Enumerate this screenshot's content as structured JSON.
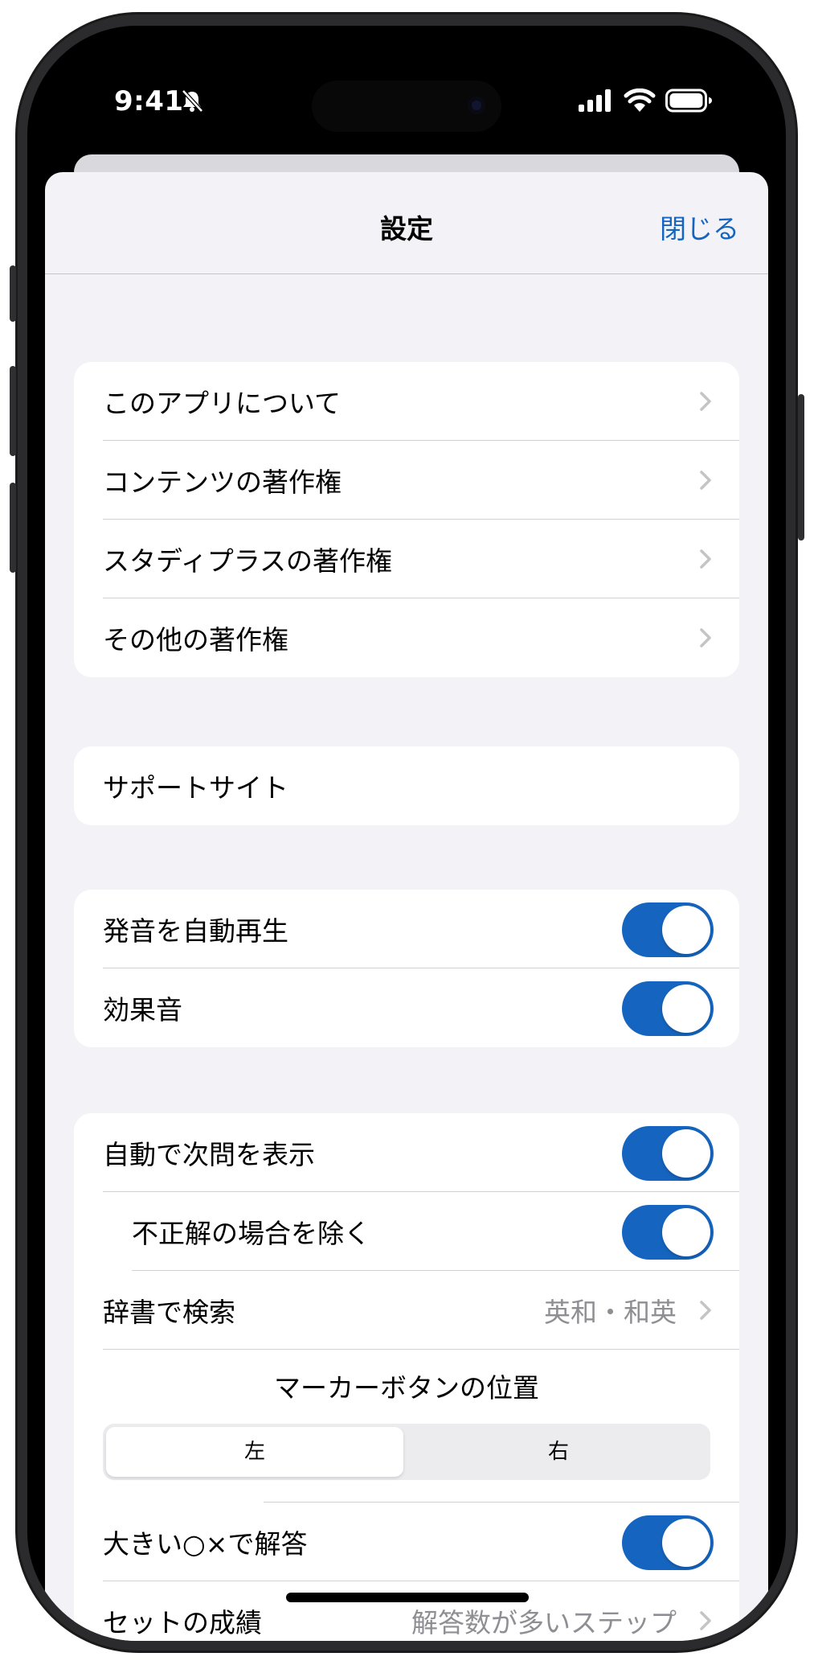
{
  "status_bar": {
    "time": "9:41"
  },
  "nav": {
    "title": "設定",
    "close_label": "閉じる"
  },
  "group1": [
    {
      "label": "このアプリについて"
    },
    {
      "label": "コンテンツの著作権"
    },
    {
      "label": "スタディプラスの著作権"
    },
    {
      "label": "その他の著作権"
    }
  ],
  "group2": [
    {
      "label": "サポートサイト"
    }
  ],
  "group3": [
    {
      "label": "発音を自動再生",
      "on": true
    },
    {
      "label": "効果音",
      "on": true
    }
  ],
  "group4": {
    "auto_next": {
      "label": "自動で次問を表示",
      "on": true
    },
    "exclude_wrong": {
      "label": "不正解の場合を除く",
      "on": true
    },
    "dictionary": {
      "label": "辞書で検索",
      "value": "英和・和英"
    },
    "marker_title": "マーカーボタンの位置",
    "marker_options": [
      "左",
      "右"
    ],
    "marker_selected": "左",
    "big_answer": {
      "label": "大きい○×で解答",
      "on": true
    },
    "set_result": {
      "label": "セットの成績",
      "value": "解答数が多いステップ"
    }
  },
  "colors": {
    "accent": "#1565c0",
    "background": "#f2f2f7"
  }
}
